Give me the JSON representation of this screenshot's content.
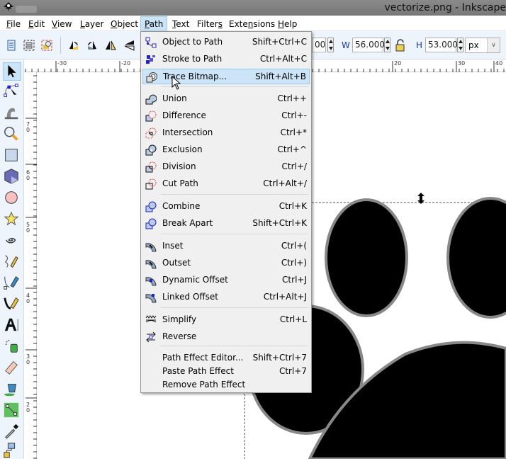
{
  "window": {
    "title": "vectorize.png - Inkscape"
  },
  "menubar": {
    "items": [
      {
        "label": "File",
        "active": false
      },
      {
        "label": "Edit",
        "active": false
      },
      {
        "label": "View",
        "active": false
      },
      {
        "label": "Layer",
        "active": false
      },
      {
        "label": "Object",
        "active": false
      },
      {
        "label": "Path",
        "active": true
      },
      {
        "label": "Text",
        "active": false
      },
      {
        "label": "Filters",
        "active": false
      },
      {
        "label": "Extensions",
        "active": false
      },
      {
        "label": "Help",
        "active": false
      }
    ]
  },
  "toolbar": {
    "x_value_partial": "00",
    "w_label": "W",
    "w_value": "56.000",
    "h_label": "H",
    "h_value": "53.000",
    "unit": "px",
    "lock_icon": "lock-open-icon"
  },
  "rulers": {
    "top_labels": [
      "-30",
      "-20",
      "20",
      "30",
      "40"
    ],
    "left_labels": [
      "70",
      "60",
      "50",
      "40",
      "30",
      "20"
    ]
  },
  "path_menu": {
    "items": [
      {
        "label": "Object to Path",
        "shortcut": "Shift+Ctrl+C",
        "icon": "object-to-path-icon"
      },
      {
        "label": "Stroke to Path",
        "shortcut": "Ctrl+Alt+C",
        "icon": "stroke-to-path-icon"
      },
      {
        "label": "Trace Bitmap...",
        "shortcut": "Shift+Alt+B",
        "icon": "trace-bitmap-icon",
        "highlighted": true
      },
      {
        "label": "Union",
        "shortcut": "Ctrl++",
        "icon": "union-icon"
      },
      {
        "label": "Difference",
        "shortcut": "Ctrl+-",
        "icon": "difference-icon"
      },
      {
        "label": "Intersection",
        "shortcut": "Ctrl+*",
        "icon": "intersection-icon"
      },
      {
        "label": "Exclusion",
        "shortcut": "Ctrl+^",
        "icon": "exclusion-icon"
      },
      {
        "label": "Division",
        "shortcut": "Ctrl+/",
        "icon": "division-icon"
      },
      {
        "label": "Cut Path",
        "shortcut": "Ctrl+Alt+/",
        "icon": "cut-path-icon"
      },
      {
        "label": "Combine",
        "shortcut": "Ctrl+K",
        "icon": "combine-icon"
      },
      {
        "label": "Break Apart",
        "shortcut": "Shift+Ctrl+K",
        "icon": "break-apart-icon"
      },
      {
        "label": "Inset",
        "shortcut": "Ctrl+(",
        "icon": "inset-icon"
      },
      {
        "label": "Outset",
        "shortcut": "Ctrl+)",
        "icon": "outset-icon"
      },
      {
        "label": "Dynamic Offset",
        "shortcut": "Ctrl+J",
        "icon": "dynamic-offset-icon"
      },
      {
        "label": "Linked Offset",
        "shortcut": "Ctrl+Alt+J",
        "icon": "linked-offset-icon"
      },
      {
        "label": "Simplify",
        "shortcut": "Ctrl+L",
        "icon": "simplify-icon"
      },
      {
        "label": "Reverse",
        "shortcut": "",
        "icon": "reverse-icon"
      },
      {
        "label": "Path Effect Editor...",
        "shortcut": "Shift+Ctrl+7",
        "icon": ""
      },
      {
        "label": "Paste Path Effect",
        "shortcut": "Ctrl+7",
        "icon": ""
      },
      {
        "label": "Remove Path Effect",
        "shortcut": "",
        "icon": ""
      }
    ]
  },
  "toolbox": {
    "tools": [
      "selector",
      "node",
      "tweak",
      "zoom",
      "rectangle",
      "3d-box",
      "ellipse",
      "star",
      "spiral",
      "pencil",
      "pen",
      "calligraphy",
      "text",
      "spray",
      "eraser",
      "paint-bucket",
      "gradient",
      "dropper",
      "connector"
    ]
  },
  "colors": {
    "menu_highlight": "#cce4f7",
    "menu_highlight_border": "#99c9ef",
    "toolbar_bg": "#eef4fb"
  }
}
